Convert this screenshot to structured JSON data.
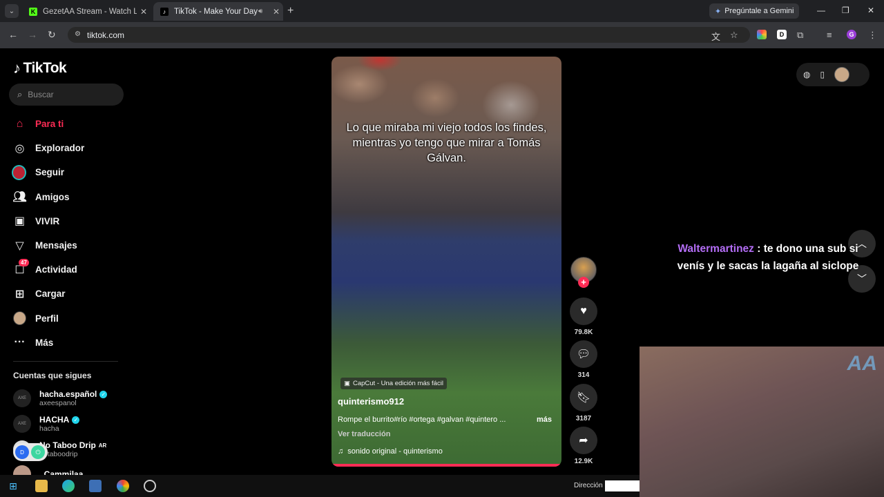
{
  "browser": {
    "tabs": [
      {
        "title": "GezetAA Stream - Watch Live o",
        "favicon_color": "#53fc18",
        "favicon": "K"
      },
      {
        "title": "TikTok - Make Your Day",
        "favicon_color": "#000000",
        "favicon": "♪"
      }
    ],
    "gemini_label": "Pregúntale a Gemini",
    "url": "tiktok.com"
  },
  "tiktok": {
    "logo": "TikTok",
    "search_placeholder": "Buscar",
    "accent": "#fe2c55",
    "nav": [
      {
        "label": "Para ti",
        "icon": "home-icon",
        "active": true
      },
      {
        "label": "Explorador",
        "icon": "compass-icon"
      },
      {
        "label": "Seguir",
        "icon": "following-avatar-icon"
      },
      {
        "label": "Amigos",
        "icon": "friends-icon"
      },
      {
        "label": "VIVIR",
        "icon": "live-icon"
      },
      {
        "label": "Mensajes",
        "icon": "messages-icon"
      },
      {
        "label": "Actividad",
        "icon": "activity-icon",
        "badge": "47"
      },
      {
        "label": "Cargar",
        "icon": "upload-icon"
      },
      {
        "label": "Perfil",
        "icon": "profile-avatar-icon"
      },
      {
        "label": "Más",
        "icon": "more-icon"
      }
    ],
    "following_title": "Cuentas que sigues",
    "following": [
      {
        "name": "hacha.español",
        "handle": "axeespanol",
        "verified": true
      },
      {
        "name": "HACHA",
        "handle": "hacha",
        "verified": true
      },
      {
        "name": "No Taboo Drip",
        "suffix": "AR",
        "handle": "notaboodrip",
        "verified": false
      },
      {
        "name": "_Cammilaa",
        "handle": "",
        "verified": false
      }
    ],
    "video": {
      "caption": "Lo que miraba mi viejo todos los findes, mientras yo tengo que mirar a Tomás Gálvan.",
      "capcut": "CapCut - Una edición más fácil",
      "username": "quinterismo912",
      "description": "Rompe el burrito#río #ortega #galvan #quintero ...",
      "more": "más",
      "translate": "Ver traducción",
      "sound": "sonido original - quinterismo"
    },
    "actions": {
      "likes": "79.8K",
      "comments": "314",
      "saves": "3187",
      "shares": "12.9K"
    }
  },
  "stream_overlay": {
    "chat_user": "Waltermartinez",
    "chat_message": " : te dono una sub si venís y le sacas la lagaña al siclope",
    "username_color": "#b36df5"
  },
  "taskbar": {
    "address_label": "Dirección"
  }
}
